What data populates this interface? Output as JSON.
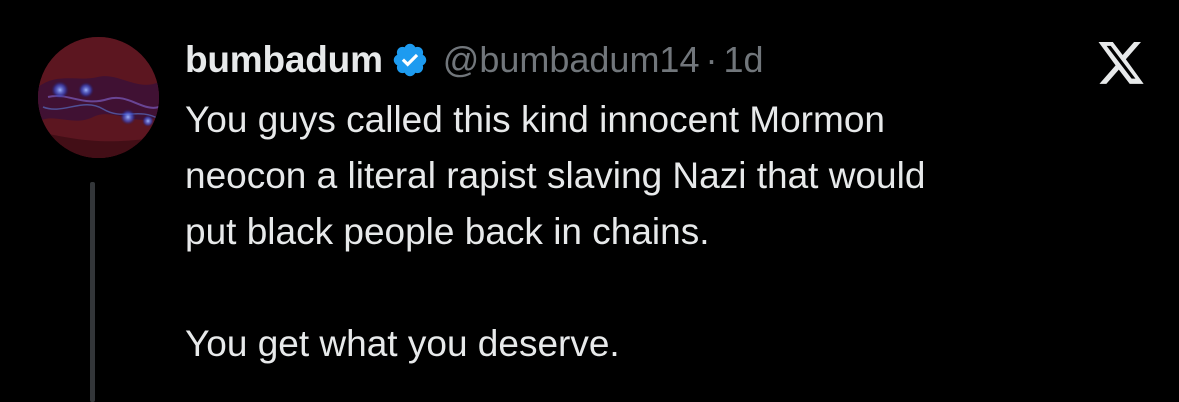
{
  "tweet": {
    "display_name": "bumbadum",
    "handle": "@bumbadum14",
    "separator": "·",
    "time": "1d",
    "verified": true,
    "text_lines": [
      "You guys called this kind innocent Mormon",
      "neocon a literal rapist slaving Nazi that would",
      "put black people back in chains."
    ],
    "text_closing": "You get what you deserve."
  },
  "icons": {
    "verified": "verified-badge-icon",
    "brand": "x-logo-icon"
  },
  "colors": {
    "background": "#000000",
    "primary_text": "#e7e9ea",
    "secondary_text": "#71767b",
    "verified_blue": "#1d9bf0",
    "thread_line": "#333639"
  }
}
